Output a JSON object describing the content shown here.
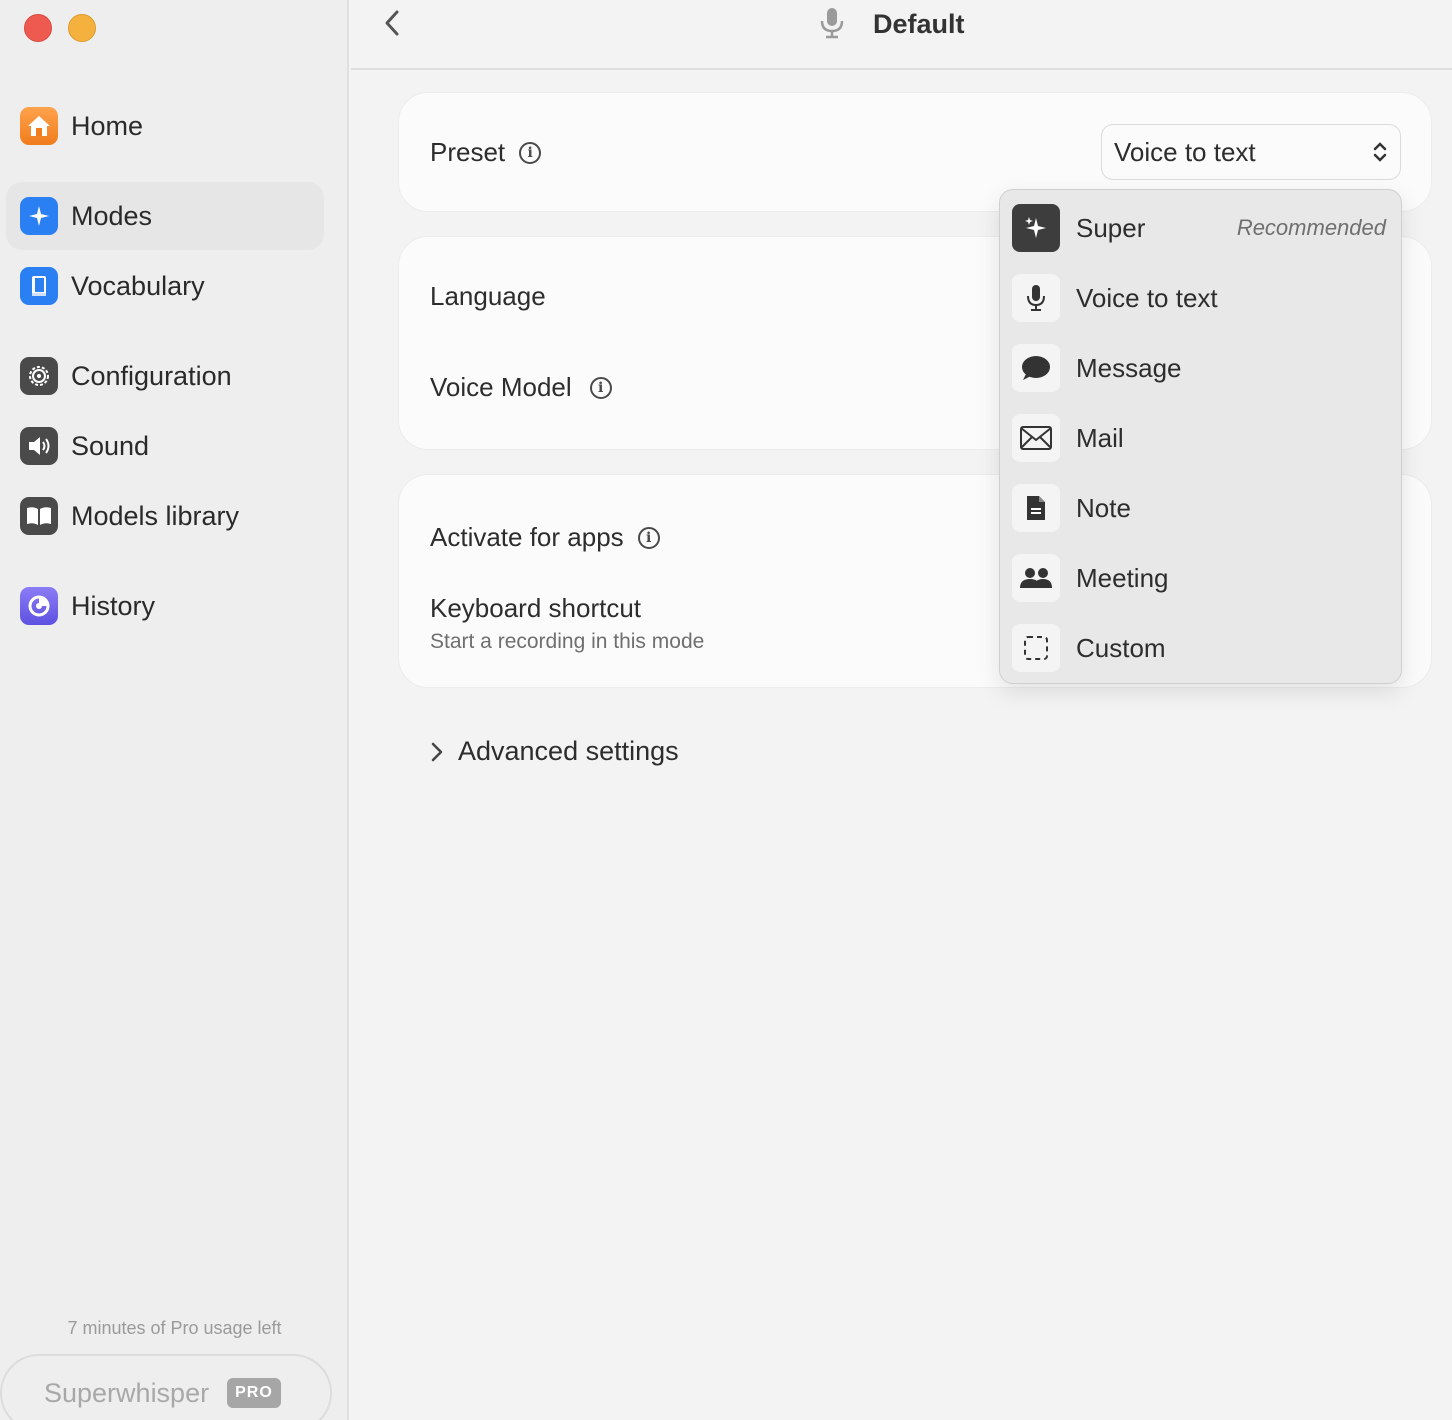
{
  "sidebar": {
    "items": [
      {
        "label": "Home",
        "icon": "home-icon"
      },
      {
        "label": "Modes",
        "icon": "sparkle-icon",
        "active": true
      },
      {
        "label": "Vocabulary",
        "icon": "book-icon"
      },
      {
        "label": "Configuration",
        "icon": "gear-icon"
      },
      {
        "label": "Sound",
        "icon": "speaker-icon"
      },
      {
        "label": "Models library",
        "icon": "open-book-icon"
      },
      {
        "label": "History",
        "icon": "history-icon"
      }
    ],
    "usage_text": "7 minutes of Pro usage left",
    "brand": "Superwhisper",
    "badge": "PRO"
  },
  "header": {
    "title": "Default"
  },
  "settings": {
    "preset_label": "Preset",
    "preset_value": "Voice to text",
    "language_label": "Language",
    "voice_model_label": "Voice Model",
    "activate_label": "Activate for apps",
    "shortcut_label": "Keyboard shortcut",
    "shortcut_sub": "Start a recording in this mode",
    "advanced_label": "Advanced settings"
  },
  "dropdown": {
    "items": [
      {
        "label": "Super",
        "tag": "Recommended",
        "icon": "sparkle-icon"
      },
      {
        "label": "Voice to text",
        "icon": "mic-icon"
      },
      {
        "label": "Message",
        "icon": "chat-bubble-icon"
      },
      {
        "label": "Mail",
        "icon": "envelope-icon"
      },
      {
        "label": "Note",
        "icon": "document-icon"
      },
      {
        "label": "Meeting",
        "icon": "people-icon"
      },
      {
        "label": "Custom",
        "icon": "dashed-square-icon"
      }
    ]
  },
  "colors": {
    "accent": "#2a7ff3",
    "close": "#ee5a4f",
    "minimize": "#f4b13d"
  }
}
